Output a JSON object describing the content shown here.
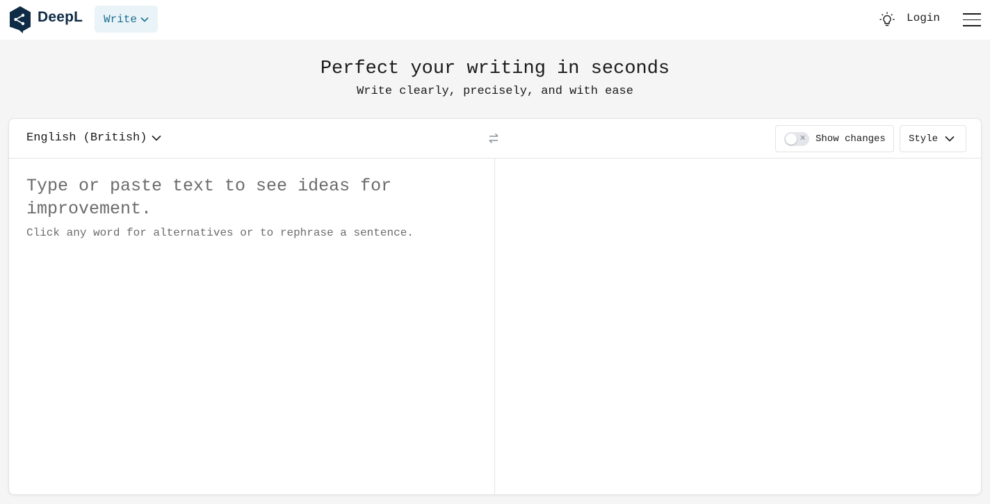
{
  "header": {
    "brand": "DeepL",
    "mode_label": "Write",
    "login_label": "Login"
  },
  "hero": {
    "title": "Perfect your writing in seconds",
    "subtitle": "Write clearly, precisely, and with ease"
  },
  "editor": {
    "language": "English (British)",
    "show_changes_label": "Show changes",
    "show_changes_on": false,
    "style_label": "Style",
    "placeholder": "Type or paste text to see ideas for improvement.",
    "hint": "Click any word for alternatives or to rephrase a sentence."
  },
  "colors": {
    "brand": "#0f2b46",
    "accent": "#1a6d94",
    "background": "#f5f5f5"
  },
  "icons": {
    "logo": "deepl-logo-icon",
    "mode_chevron": "chevron-down-icon",
    "theme": "lightbulb-icon",
    "menu": "hamburger-menu-icon",
    "swap": "swap-arrows-icon",
    "close": "close-icon"
  }
}
